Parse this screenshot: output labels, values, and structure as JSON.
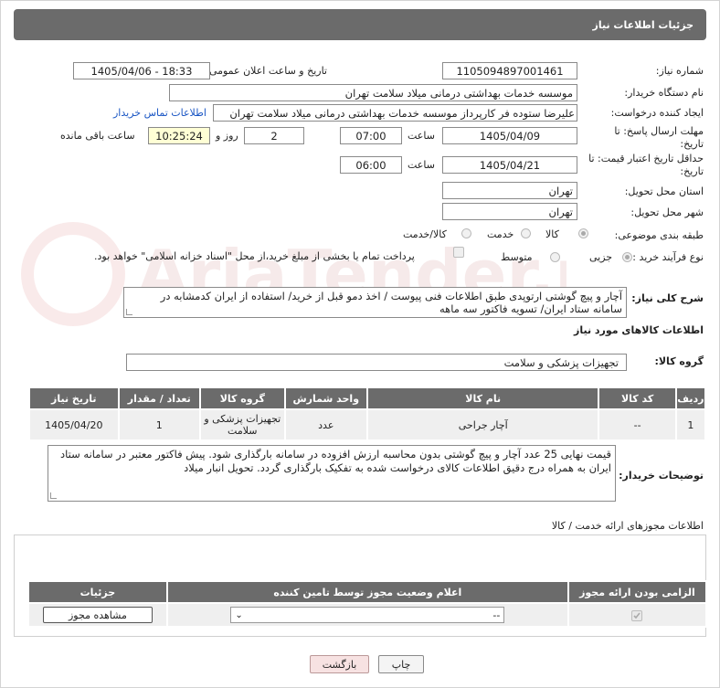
{
  "header": {
    "title": "جزئیات اطلاعات نیاز"
  },
  "fields": {
    "need_number_label": "شماره نیاز:",
    "need_number": "1105094897001461",
    "announce_label": "تاریخ و ساعت اعلان عمومی:",
    "announce_value": "1405/04/06 - 18:33",
    "buyer_org_label": "نام دستگاه خریدار:",
    "buyer_org": "موسسه خدمات بهداشتی درمانی میلاد سلامت تهران",
    "requester_label": "ایجاد کننده درخواست:",
    "requester": "علیرضا ستوده فر کارپرداز موسسه خدمات بهداشتی درمانی میلاد سلامت تهران",
    "buyer_contact_link": "اطلاعات تماس خریدار",
    "reply_deadline_label": "مهلت ارسال پاسخ: تا تاریخ:",
    "reply_date": "1405/04/09",
    "time_label": "ساعت",
    "reply_time": "07:00",
    "days_value": "2",
    "days_label": "روز و",
    "remaining_time": "10:25:24",
    "remaining_label": "ساعت باقی مانده",
    "price_validity_label": "حداقل تاریخ اعتبار قیمت: تا تاریخ:",
    "price_date": "1405/04/21",
    "price_time": "06:00",
    "province_label": "استان محل تحویل:",
    "province": "تهران",
    "city_label": "شهر محل تحویل:",
    "city": "تهران",
    "category_label": "طبقه بندی موضوعی:",
    "category_options": [
      "کالا",
      "خدمت",
      "کالا/خدمت"
    ],
    "process_label": "نوع فرآیند خرید :",
    "process_options": [
      "جزیی",
      "متوسط"
    ],
    "payment_text": "پرداخت تمام یا بخشی از مبلغ خرید،از محل \"اسناد خزانه اسلامی\" خواهد بود."
  },
  "description": {
    "label": "شرح کلی نیاز:",
    "text": "آچار و پیچ گوشتی ارتوپدی طبق اطلاعات فنی پیوست / اخذ دمو قبل از خرید/ استفاده از ایران کدمشابه در سامانه ستاد ایران/ تسویه فاکتور سه ماهه"
  },
  "goods": {
    "section_title": "اطلاعات کالاهای مورد نیاز",
    "group_label": "گروه کالا:",
    "group_value": "تجهیزات پزشکی و سلامت",
    "columns": [
      "ردیف",
      "کد کالا",
      "نام کالا",
      "واحد شمارش",
      "گروه کالا",
      "تعداد / مقدار",
      "تاریخ نیاز"
    ],
    "rows": [
      [
        "1",
        "--",
        "آچار جراحی",
        "عدد",
        "تجهیزات پزشکی و سلامت",
        "1",
        "1405/04/20"
      ]
    ]
  },
  "buyer_notes": {
    "label": "توضیحات خریدار:",
    "text": "قیمت نهایی 25 عدد آچار و پیچ گوشتی بدون محاسبه ارزش افزوده در سامانه بارگذاری شود. پیش فاکتور معتبر در سامانه ستاد ایران به همراه درج دقیق اطلاعات کالای درخواست شده به تفکیک بارگذاری گردد. تحویل انبار میلاد"
  },
  "permits": {
    "section_title": "اطلاعات مجوزهای ارائه خدمت / کالا",
    "columns": [
      "الزامی بودن ارائه مجوز",
      "اعلام وضعیت مجوز توسط تامین کننده",
      "جزئیات"
    ],
    "select_value": "--",
    "view_button": "مشاهده مجوز"
  },
  "footer": {
    "print_button": "چاپ",
    "back_button": "بازگشت"
  },
  "watermark_text": "AriaTender.neT"
}
